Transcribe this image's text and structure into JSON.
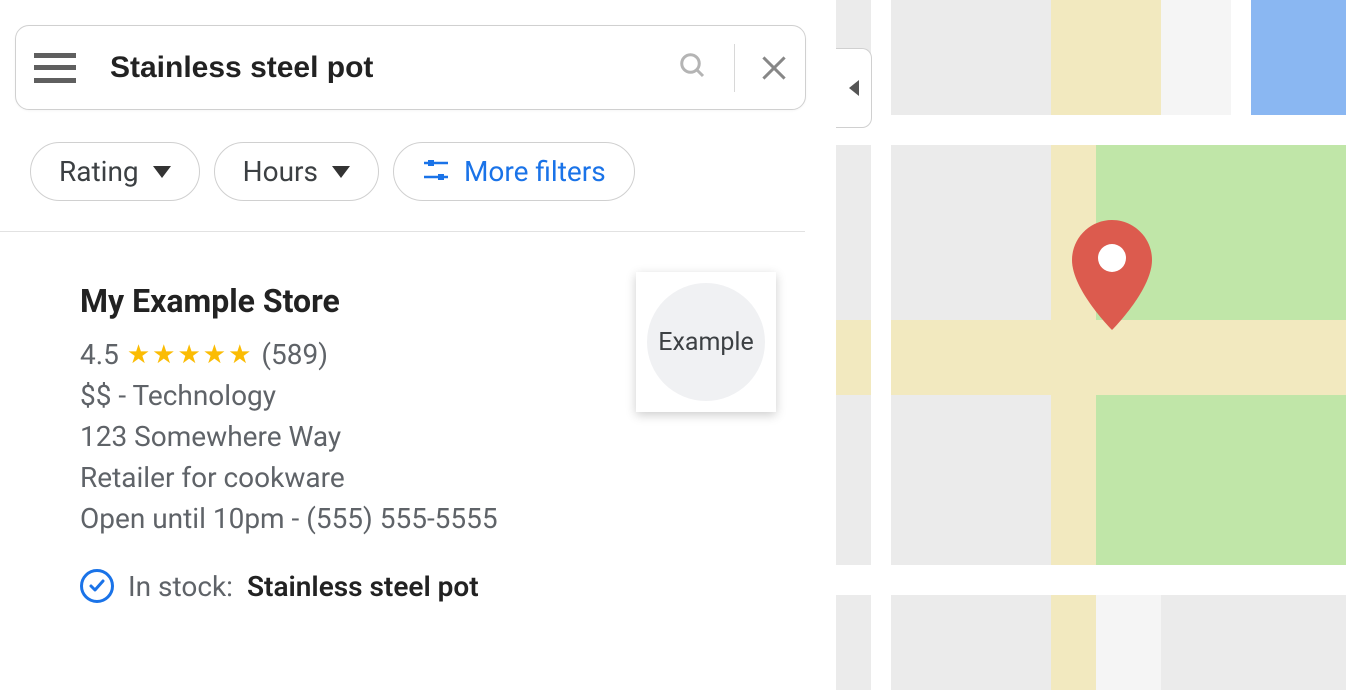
{
  "search": {
    "query": "Stainless steel pot"
  },
  "filters": {
    "rating_label": "Rating",
    "hours_label": "Hours",
    "more_label": "More filters"
  },
  "result": {
    "name": "My Example Store",
    "rating": "4.5",
    "stars": "★★★★★",
    "review_count": "(589)",
    "price_category": "$$ - Technology",
    "address": "123 Somewhere Way",
    "description": "Retailer for cookware",
    "hours_phone": "Open until 10pm - (555) 555-5555",
    "stock_prefix": "In stock:",
    "stock_item": "Stainless steel pot",
    "thumb_label": "Example"
  },
  "colors": {
    "link_blue": "#1a73e8",
    "star_yellow": "#fbbc04",
    "pin_red": "#dc5b4e"
  }
}
